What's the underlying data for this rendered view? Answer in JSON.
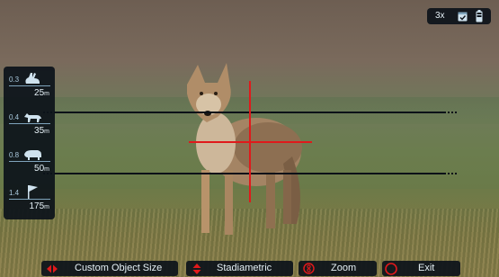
{
  "status": {
    "zoom_level": "3x",
    "calibration_icon": "calendar-check-icon",
    "battery_icon": "battery-icon"
  },
  "objects": [
    {
      "name": "rabbit",
      "size": "0.3",
      "distance_value": "25",
      "distance_unit": "m",
      "icon": "rabbit-icon"
    },
    {
      "name": "fox",
      "size": "0.4",
      "distance_value": "35",
      "distance_unit": "m",
      "icon": "fox-icon"
    },
    {
      "name": "boar",
      "size": "0.8",
      "distance_value": "50",
      "distance_unit": "m",
      "icon": "boar-icon"
    },
    {
      "name": "flag",
      "size": "1.4",
      "distance_value": "175",
      "distance_unit": "m",
      "icon": "flag-icon"
    }
  ],
  "bottom_bar": {
    "custom_object_size": "Custom Object Size",
    "stadiametric": "Stadiametric",
    "zoom": "Zoom",
    "exit": "Exit"
  },
  "colors": {
    "reticle": "#e0191b",
    "panel_bg": "#0c121a",
    "accent_red": "#e0191b",
    "text": "#e6f1f7"
  }
}
